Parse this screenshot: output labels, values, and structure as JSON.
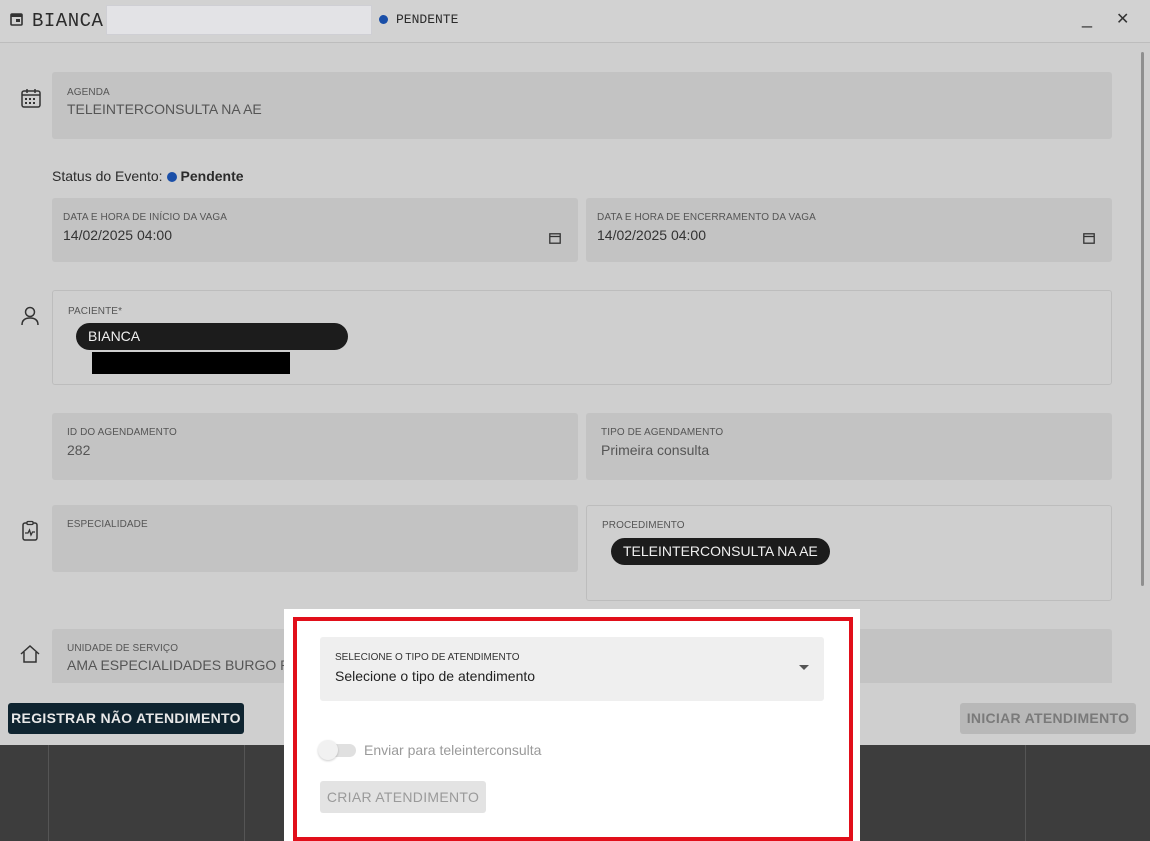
{
  "header": {
    "title": "BIANCA",
    "status": "PENDENTE",
    "minimize_glyph": "_",
    "close_glyph": "✕"
  },
  "agenda": {
    "label": "AGENDA",
    "value": "TELEINTERCONSULTA NA AE"
  },
  "event_status": {
    "label": "Status do Evento:",
    "value": "Pendente"
  },
  "start": {
    "label": "DATA E HORA DE INÍCIO DA VAGA",
    "value": "14/02/2025 04:00"
  },
  "end": {
    "label": "DATA E HORA DE ENCERRAMENTO DA VAGA",
    "value": "14/02/2025 04:00"
  },
  "patient": {
    "label": "PACIENTE*",
    "chip": "BIANCA"
  },
  "appointment_id": {
    "label": "ID DO AGENDAMENTO",
    "value": "282"
  },
  "appointment_type": {
    "label": "TIPO DE AGENDAMENTO",
    "value": "Primeira consulta"
  },
  "specialty": {
    "label": "ESPECIALIDADE",
    "value": ""
  },
  "procedure": {
    "label": "PROCEDIMENTO",
    "chip": "TELEINTERCONSULTA NA AE"
  },
  "service_unit": {
    "label": "UNIDADE DE SERVIÇO",
    "value": "AMA ESPECIALIDADES BURGO PA"
  },
  "actions": {
    "register_no_attendance": "REGISTRAR NÃO ATENDIMENTO",
    "start_attendance": "INICIAR ATENDIMENTO"
  },
  "popup": {
    "select_label": "SELECIONE O TIPO DE ATENDIMENTO",
    "select_value": "Selecione o tipo de atendimento",
    "toggle_label": "Enviar para teleinterconsulta",
    "create_button": "CRIAR ATENDIMENTO",
    "highlight_color": "#e10f1a"
  },
  "icons": [
    "calendar-icon",
    "person-icon",
    "clipboard-pulse-icon",
    "home-icon",
    "event-icon"
  ]
}
